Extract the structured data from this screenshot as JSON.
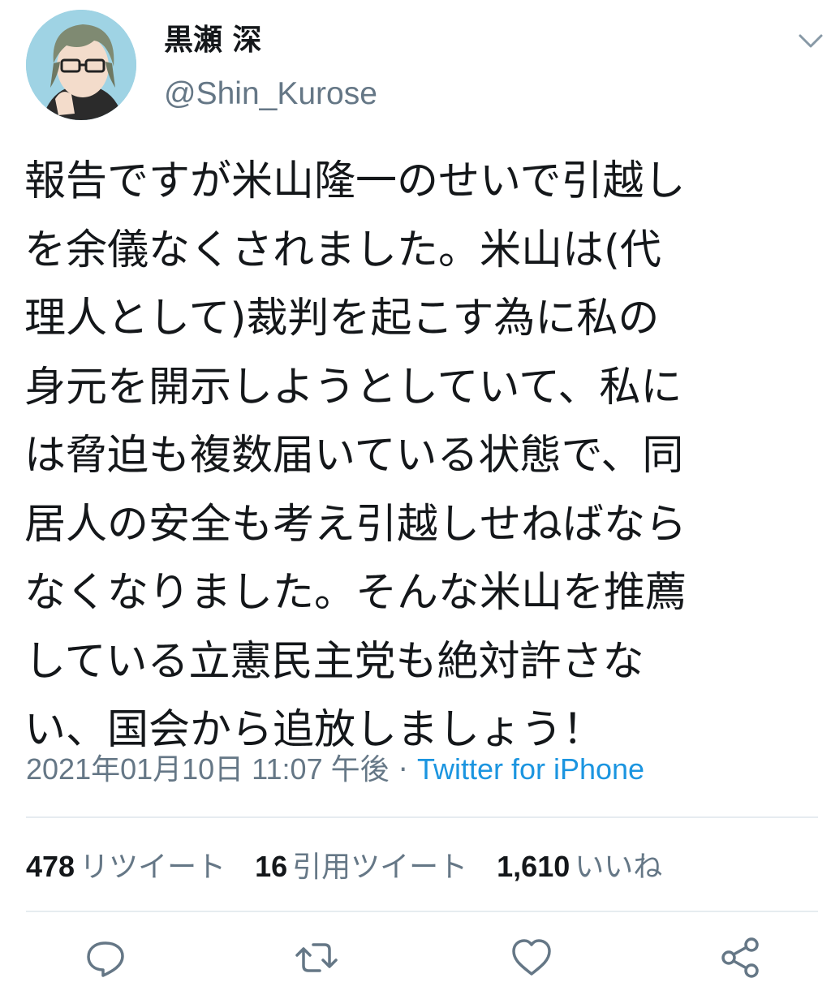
{
  "user": {
    "display_name": "黒瀬 深",
    "handle": "@Shin_Kurose",
    "avatar_icon": "avatar-anime-glasses"
  },
  "tweet": {
    "lines": [
      "報告ですが米山隆一のせいで引越し",
      "を余儀なくされました。米山は(代",
      "理人として)裁判を起こす為に私の",
      "身元を開示しようとしていて、私に",
      "は脅迫も複数届いている状態で、同",
      "居人の安全も考え引越しせねばなら",
      "なくなりました。そんな米山を推薦",
      "している立憲民主党も絶対許さな",
      "い、国会から追放しましょう！"
    ]
  },
  "meta": {
    "timestamp": "2021年01月10日 11:07 午後",
    "separator": " · ",
    "source": "Twitter for iPhone"
  },
  "stats": {
    "retweets": {
      "count": "478",
      "label": "リツイート"
    },
    "quotes": {
      "count": "16",
      "label": "引用ツイート"
    },
    "likes": {
      "count": "1,610",
      "label": "いいね"
    }
  },
  "actions": {
    "icons": [
      "reply-icon",
      "retweet-icon",
      "like-icon",
      "share-icon"
    ]
  },
  "colors": {
    "text": "#14171a",
    "secondary": "#657786",
    "link": "#1b95e0",
    "divider": "#e6ecf0"
  }
}
